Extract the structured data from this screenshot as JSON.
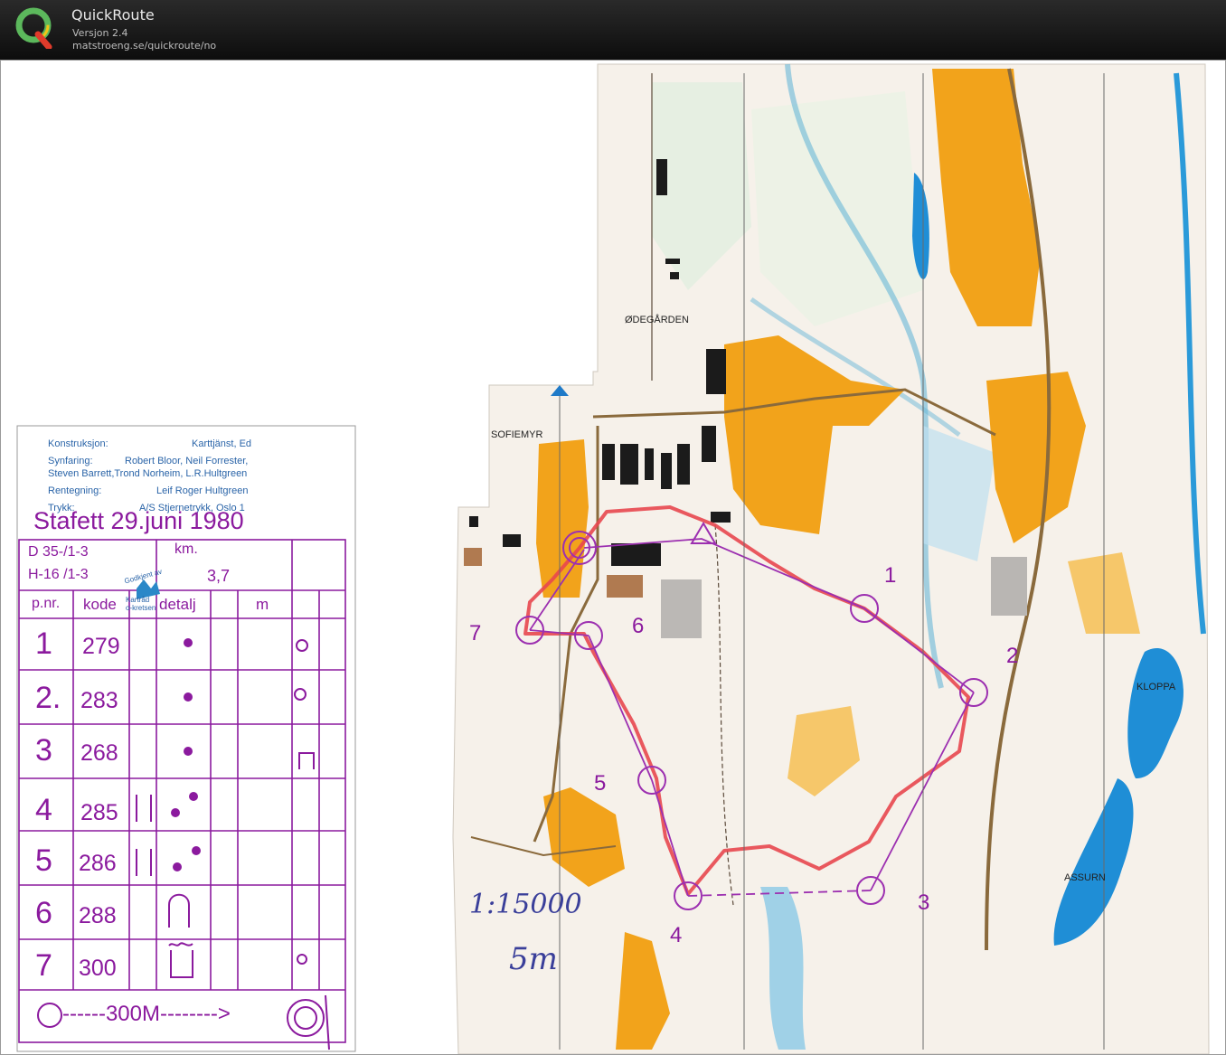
{
  "app": {
    "title": "QuickRoute",
    "version": "Versjon 2.4",
    "url": "matstroeng.se/quickroute/no"
  },
  "legend": {
    "konstruksjon_label": "Konstruksjon:",
    "konstruksjon_value": "Karttjänst, Ed",
    "synfaring_label": "Synfaring:",
    "synfaring_line1": "Robert Bloor, Neil Forrester,",
    "synfaring_line2": "Steven Barrett,Trond Norheim,  L.R.Hultgreen",
    "rentegning_label": "Rentegning:",
    "rentegning_value": "Leif Roger Hultgreen",
    "trykk_label": "Trykk:",
    "trykk_value": "A/S Stjernetrykk, Oslo 1",
    "approval_line1": "Godkjent av",
    "approval_line2": "Kartråd",
    "approval_line3": "o-kretsen"
  },
  "course_card": {
    "event": "Stafett  29.juni  1980",
    "class1": "D 35-/1-3",
    "class2": "H-16 /1-3",
    "km_label": "km.",
    "km_value": "3,7",
    "col_pnr": "p.nr.",
    "col_kode": "kode",
    "col_detalj": "detalj",
    "col_m": "m",
    "rows": [
      {
        "nr": "1",
        "kode": "279"
      },
      {
        "nr": "2.",
        "kode": "283"
      },
      {
        "nr": "3",
        "kode": "268"
      },
      {
        "nr": "4",
        "kode": "285"
      },
      {
        "nr": "5",
        "kode": "286"
      },
      {
        "nr": "6",
        "kode": "288"
      },
      {
        "nr": "7",
        "kode": "300"
      }
    ],
    "finish_text": "------300M-------->"
  },
  "map_labels": {
    "odegarden": "ØDEGÅRDEN",
    "sofiemyr": "SOFIEMYR",
    "kloppa": "KLOPPA",
    "assurn": "ASSURN"
  },
  "controls": {
    "c1": "1",
    "c2": "2",
    "c3": "3",
    "c4": "4",
    "c5": "5",
    "c6": "6",
    "c7": "7"
  },
  "hand_notes": {
    "scale": "1:15000",
    "contour": "5m"
  },
  "colors": {
    "titlebar": "#151515",
    "course_purple": "#8b1a9e",
    "route_red": "#e8474f",
    "forest_orange": "#f2a31b",
    "water_blue": "#1f8ed6",
    "legend_blue": "#2a64a8"
  }
}
